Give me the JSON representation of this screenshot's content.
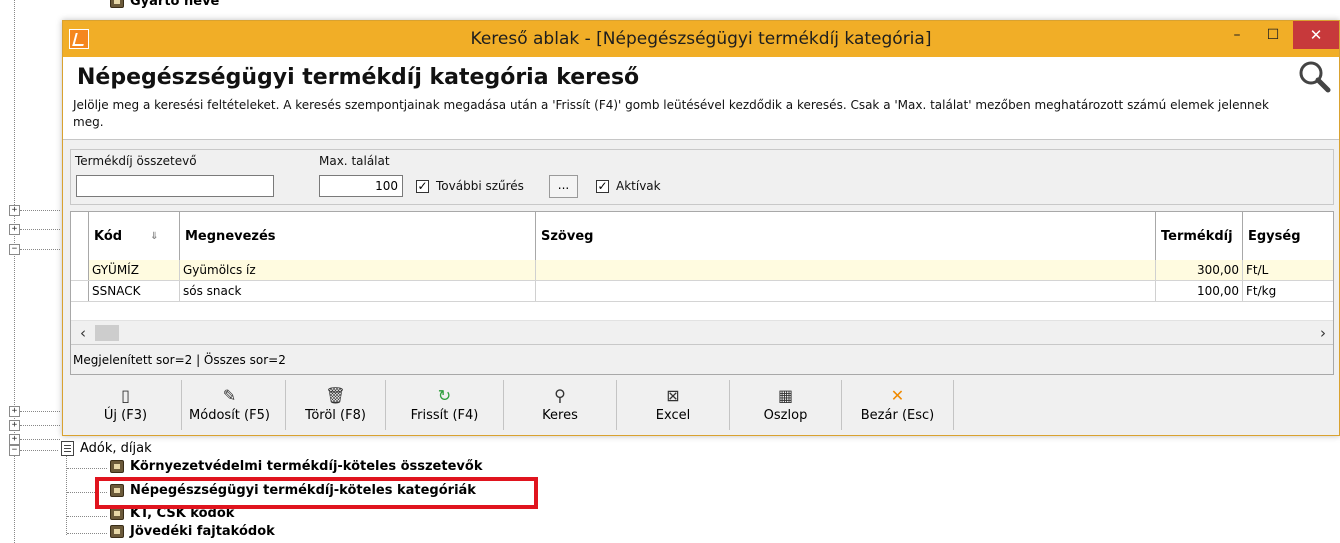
{
  "background_tree": {
    "top_item": "Gyártó neve",
    "group_label": "Adók, díjak",
    "items": [
      "Környezetvédelmi termékdíj-köteles összetevők",
      "Népegészségügyi termékdíj-köteles kategóriák",
      "KT, CSK kódok",
      "Jövedéki fajtakódok"
    ],
    "highlighted_item_index": 1,
    "highlight_color": "#e0141e"
  },
  "window": {
    "title": "Kereső ablak - [Népegészségügyi termékdíj kategória]",
    "title_bar_color": "#f1ae27",
    "controls": {
      "minimize": "–",
      "maximize": "☐",
      "close": "✕"
    }
  },
  "header": {
    "title": "Népegészségügyi termékdíj kategória kereső",
    "description": "Jelölje meg a keresési feltételeket. A keresés szempontjainak megadása után a 'Frissít (F4)' gomb leütésével kezdődik a keresés. Csak a 'Max. találat' mezőben meghatározott számú elemek jelennek meg."
  },
  "filters": {
    "component_label": "Termékdíj összetevő",
    "component_value": "",
    "max_hits_label": "Max. találat",
    "max_hits_value": "100",
    "more_filter_label": "További szűrés",
    "more_filter_checked": true,
    "ellipsis_label": "...",
    "active_label": "Aktívak",
    "active_checked": true
  },
  "grid": {
    "columns": [
      "Kód",
      "Megnevezés",
      "Szöveg",
      "Termékdíj",
      "Egység"
    ],
    "rows": [
      {
        "kod": "GYÜMÍZ",
        "megnevezes": "Gyümölcs íz",
        "szoveg": "",
        "termekdij": "300,00",
        "egyseg": "Ft/L"
      },
      {
        "kod": "SSNACK",
        "megnevezes": "sós snack",
        "szoveg": "",
        "termekdij": "100,00",
        "egyseg": "Ft/kg"
      }
    ],
    "selected_row_color": "#fffbe0",
    "status": "Megjelenített sor=2 | Összes sor=2"
  },
  "toolbar": {
    "buttons": [
      {
        "label": "Új (F3)",
        "icon": "new-document-icon",
        "glyph": "▯"
      },
      {
        "label": "Módosít (F5)",
        "icon": "edit-icon",
        "glyph": "✎"
      },
      {
        "label": "Töröl (F8)",
        "icon": "trash-icon",
        "glyph": "🗑"
      },
      {
        "label": "Frissít (F4)",
        "icon": "refresh-icon",
        "glyph": "↻"
      },
      {
        "label": "Keres",
        "icon": "search-icon",
        "glyph": "⚲"
      },
      {
        "label": "Excel",
        "icon": "excel-icon",
        "glyph": "⊠"
      },
      {
        "label": "Oszlop",
        "icon": "columns-icon",
        "glyph": "▦"
      },
      {
        "label": "Bezár (Esc)",
        "icon": "close-icon",
        "glyph": "✕"
      }
    ],
    "refresh_icon_color": "#2e9e3c",
    "close_icon_color": "#f08a00"
  }
}
